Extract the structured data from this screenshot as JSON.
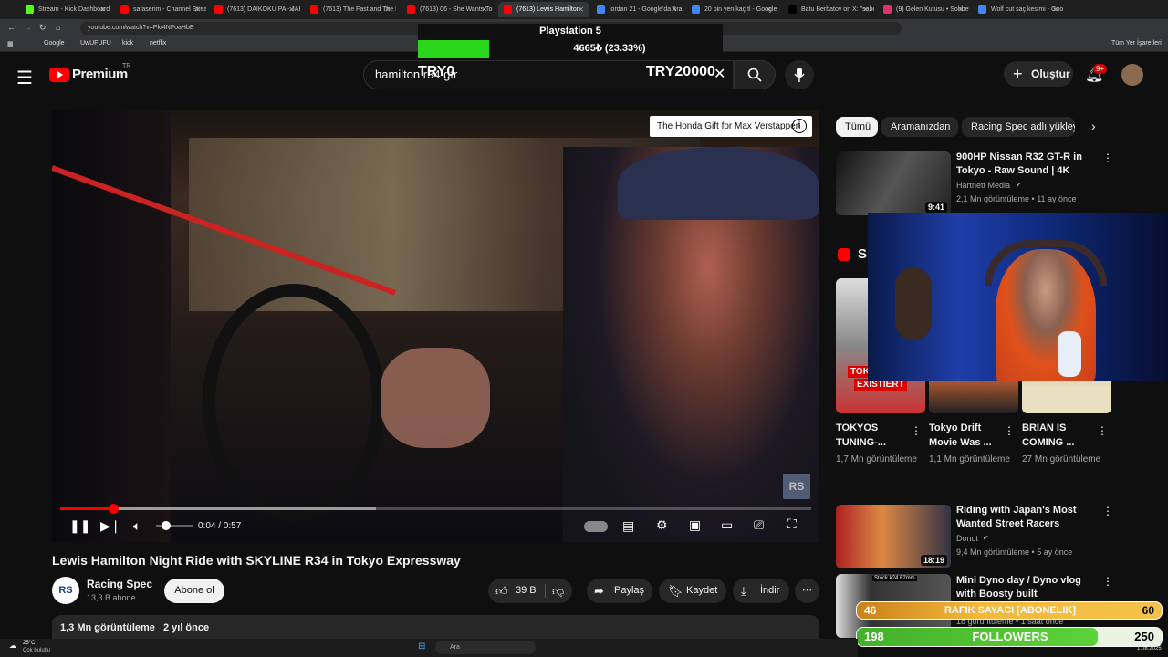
{
  "browser": {
    "tabs": [
      {
        "label": "Stream - Kick Dashboard",
        "color": "#53fc18"
      },
      {
        "label": "safaserim - Channel Stream",
        "color": "#ff0000"
      },
      {
        "label": "(7613) DAIKOKU PA - JAP",
        "color": "#ff0000"
      },
      {
        "label": "(7613) The Fast and The F",
        "color": "#ff0000"
      },
      {
        "label": "(7613) 06 - She Wants To",
        "color": "#ff0000"
      },
      {
        "label": "(7613) Lewis Hamilton",
        "color": "#ff0000"
      },
      {
        "label": "jordan 21 - Google'da Ara",
        "color": "#4285f4"
      },
      {
        "label": "20 bin yen kaç tl - Google",
        "color": "#4285f4"
      },
      {
        "label": "Batu Berbatov on X: \"sabe",
        "color": "#000000"
      },
      {
        "label": "(9) Gelen Kutusu • Sohbet",
        "color": "#e1306c"
      },
      {
        "label": "Wolf cut saç kesimi - Goo",
        "color": "#4285f4"
      }
    ],
    "url": "youtube.com/watch?v=Pkt4NFoaHbE",
    "bookmarks": [
      "Google",
      "UwUFUFU",
      "kick",
      "netflix"
    ],
    "all_bookmarks": "Tüm Yer İşaretleri"
  },
  "overlay_goal": {
    "title": "Playstation 5",
    "progress_text": "4665₺ (23.33%)",
    "progress_fraction": 0.2333,
    "left_label": "TRY0",
    "right_label": "TRY20000"
  },
  "header": {
    "logo": "Premium",
    "region": "TR",
    "search_value": "hamilton r34 gtr",
    "create_label": "Oluştur",
    "notif_badge": "9+"
  },
  "video": {
    "info_card": "The Honda Gift for Max Verstappen",
    "watermark": "RS",
    "time": "0:04 / 0:57",
    "progress_fraction": 0.07,
    "buffered_fraction": 0.42,
    "title": "Lewis Hamilton Night Ride with SKYLINE R34 in Tokyo Expressway",
    "channel": "Racing Spec",
    "channel_logo": "RS",
    "subscribers": "13,3 B abone",
    "subscribe_label": "Abone ol",
    "likes": "39 B",
    "share_label": "Paylaş",
    "save_label": "Kaydet",
    "download_label": "İndir",
    "views": "1,3 Mn görüntüleme",
    "age": "2 yıl önce"
  },
  "sidebar": {
    "chips": [
      "Tümü",
      "Aramanızdan",
      "Racing Spec adlı yükleyici"
    ],
    "related": [
      {
        "title": "900HP Nissan R32 GT-R in Tokyo - Raw Sound | 4K",
        "channel": "Hartnett Media",
        "meta": "2,1 Mn görüntüleme • 11 ay önce",
        "duration": "9:41"
      },
      {
        "title": "Riding with Japan's Most Wanted Street Racers",
        "channel": "Donut",
        "meta": "9,4 Mn görüntüleme • 5 ay önce",
        "duration": "18:19"
      },
      {
        "title": "Mini Dyno day / Dyno vlog with Boosty built",
        "channel": "",
        "meta": "18 görüntüleme • 1 saat önce",
        "duration": ""
      }
    ],
    "shorts_header": "S",
    "shorts": [
      {
        "title": "TOKYOS TUNING-...",
        "views": "1,7 Mn görüntüleme",
        "tag": "EXISTIERT",
        "tag2": "TOK"
      },
      {
        "title": "Tokyo Drift Movie Was ...",
        "views": "1,1 Mn görüntüleme",
        "tag": "",
        "tag2": ""
      },
      {
        "title": "BRIAN IS COMING ...",
        "views": "27 Mn görüntüleme",
        "tag": "",
        "tag2": ""
      }
    ],
    "mini_thumb_label": "Stock k24 62mm"
  },
  "stream_widgets": {
    "rafik_left": "46",
    "rafik_label": "RAFIK SAYACI [ABONELIK]",
    "rafik_right": "60",
    "followers_left": "198",
    "followers_label": "FOLLOWERS",
    "followers_right": "250",
    "followers_fraction": 0.79
  },
  "taskbar": {
    "weather_temp": "25°C",
    "weather_desc": "Çok bulutlu",
    "search_placeholder": "Ara",
    "date": "1.08.2025"
  }
}
